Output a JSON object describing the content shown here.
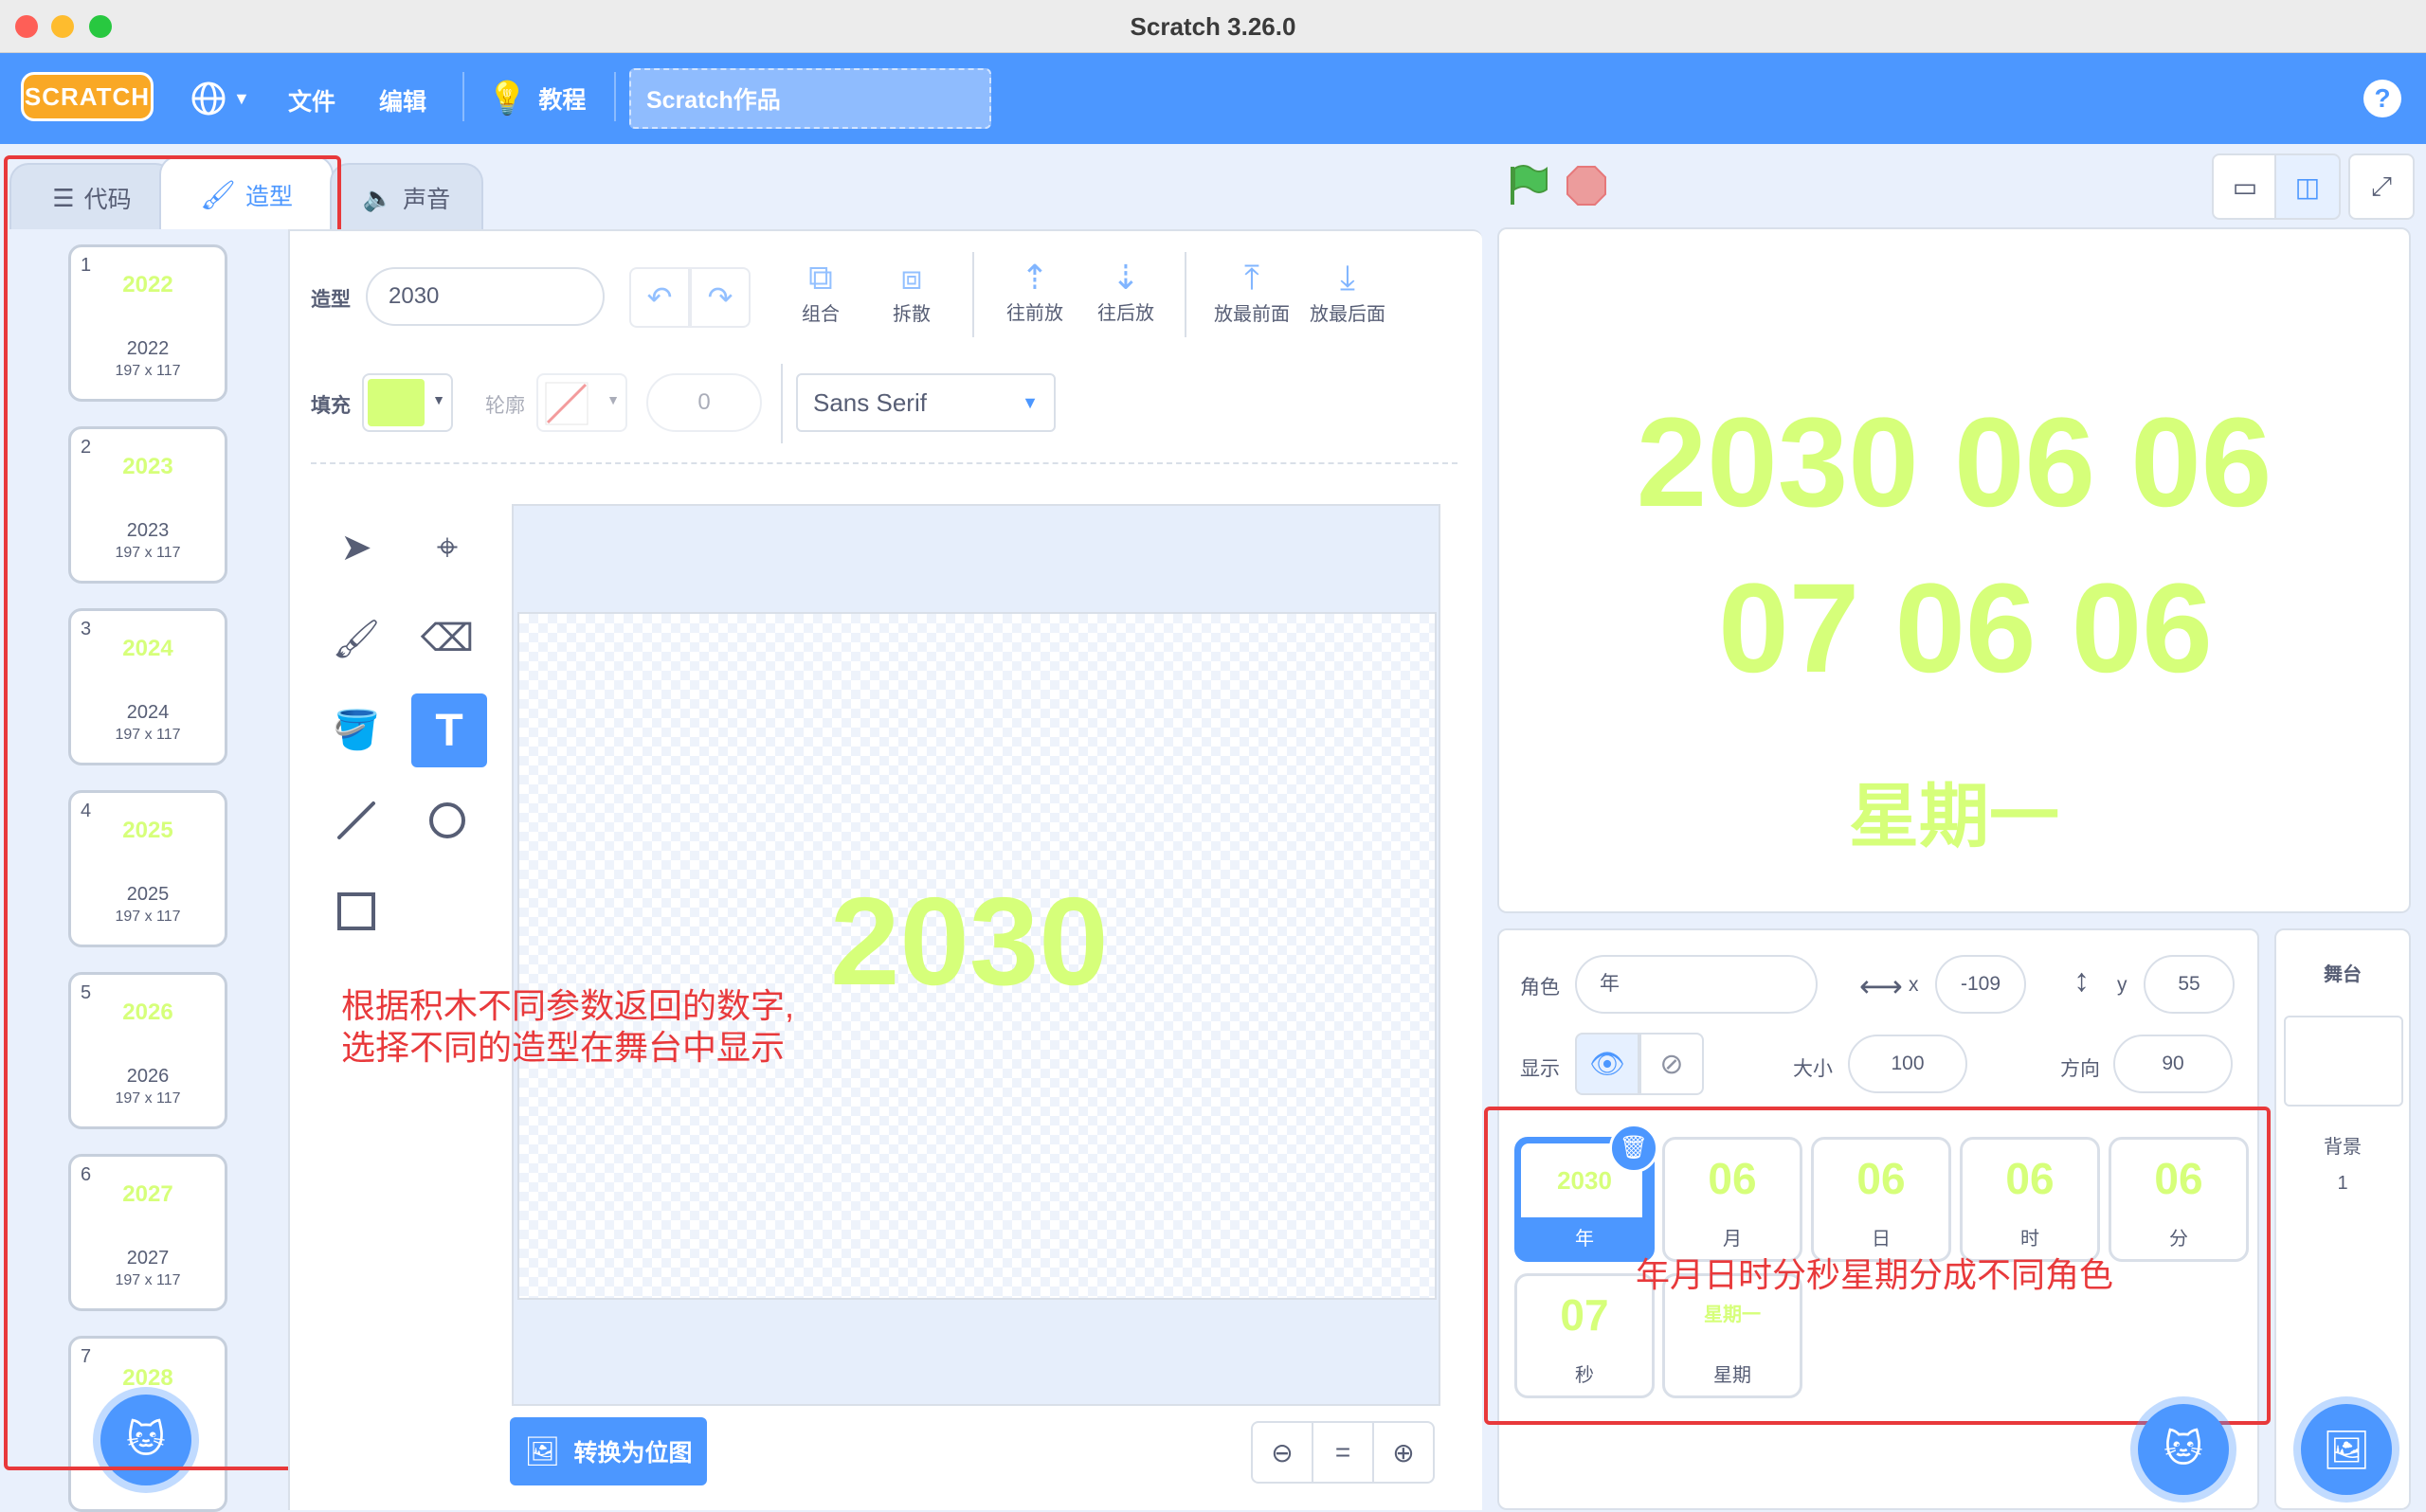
{
  "window": {
    "title": "Scratch 3.26.0"
  },
  "menubar": {
    "logo": "SCRATCH",
    "file": "文件",
    "edit": "编辑",
    "tutorials": "教程",
    "project_title": "Scratch作品",
    "help": "?"
  },
  "tabs": {
    "code": "代码",
    "costumes": "造型",
    "sounds": "声音"
  },
  "costumes": [
    {
      "num": "1",
      "thumb": "2022",
      "name": "2022",
      "dims": "197 x 117"
    },
    {
      "num": "2",
      "thumb": "2023",
      "name": "2023",
      "dims": "197 x 117"
    },
    {
      "num": "3",
      "thumb": "2024",
      "name": "2024",
      "dims": "197 x 117"
    },
    {
      "num": "4",
      "thumb": "2025",
      "name": "2025",
      "dims": "197 x 117"
    },
    {
      "num": "5",
      "thumb": "2026",
      "name": "2026",
      "dims": "197 x 117"
    },
    {
      "num": "6",
      "thumb": "2027",
      "name": "2027",
      "dims": "197 x 117"
    },
    {
      "num": "7",
      "thumb": "2028"
    }
  ],
  "editor": {
    "costume_label": "造型",
    "costume_name": "2030",
    "group": "组合",
    "ungroup": "拆散",
    "forward": "往前放",
    "backward": "往后放",
    "front": "放最前面",
    "back": "放最后面",
    "fill_label": "填充",
    "fill_color": "#d6ff7a",
    "outline_label": "轮廓",
    "outline_width": "0",
    "font": "Sans Serif",
    "canvas_text": "2030",
    "convert_bitmap": "转换为位图",
    "zoom_reset": "="
  },
  "stage": {
    "line1": "2030 06 06",
    "line2": "07 06 06",
    "line3": "星期一"
  },
  "sprite_info": {
    "sprite_label": "角色",
    "sprite_name": "年",
    "x_label": "x",
    "x_value": "-109",
    "y_label": "y",
    "y_value": "55",
    "show_label": "显示",
    "size_label": "大小",
    "size_value": "100",
    "direction_label": "方向",
    "direction_value": "90"
  },
  "sprites": [
    {
      "big": "2030",
      "name": "年",
      "selected": true
    },
    {
      "big": "06",
      "name": "月"
    },
    {
      "big": "06",
      "name": "日"
    },
    {
      "big": "06",
      "name": "时"
    },
    {
      "big": "06",
      "name": "分"
    },
    {
      "big": "07",
      "name": "秒"
    },
    {
      "big": "星期一",
      "name": "星期"
    }
  ],
  "stage_panel": {
    "title": "舞台",
    "backdrop_label": "背景",
    "backdrop_count": "1"
  },
  "annotations": {
    "costume_note_line1": "根据积木不同参数返回的数字,",
    "costume_note_line2": "选择不同的造型在舞台中显示",
    "sprite_note": "年月日时分秒星期分成不同角色"
  }
}
